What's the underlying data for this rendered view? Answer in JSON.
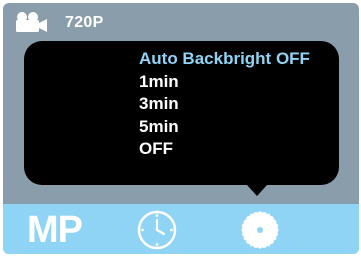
{
  "top_bar": {
    "camera_icon": "video-camera-icon",
    "resolution": "720P"
  },
  "menu": {
    "title": "Auto Backbright OFF",
    "options": [
      "1min",
      "3min",
      "5min",
      "OFF"
    ]
  },
  "bottom_bar": {
    "mode_label": "MP",
    "timer_icon": "timer-clock-icon",
    "settings_icon": "settings-gear-icon"
  },
  "colors": {
    "screen_background": "#8a9daa",
    "bottom_bar": "#8fd3f5",
    "highlight": "#8fd3f5",
    "menu_background": "#000000",
    "text": "#ffffff"
  }
}
